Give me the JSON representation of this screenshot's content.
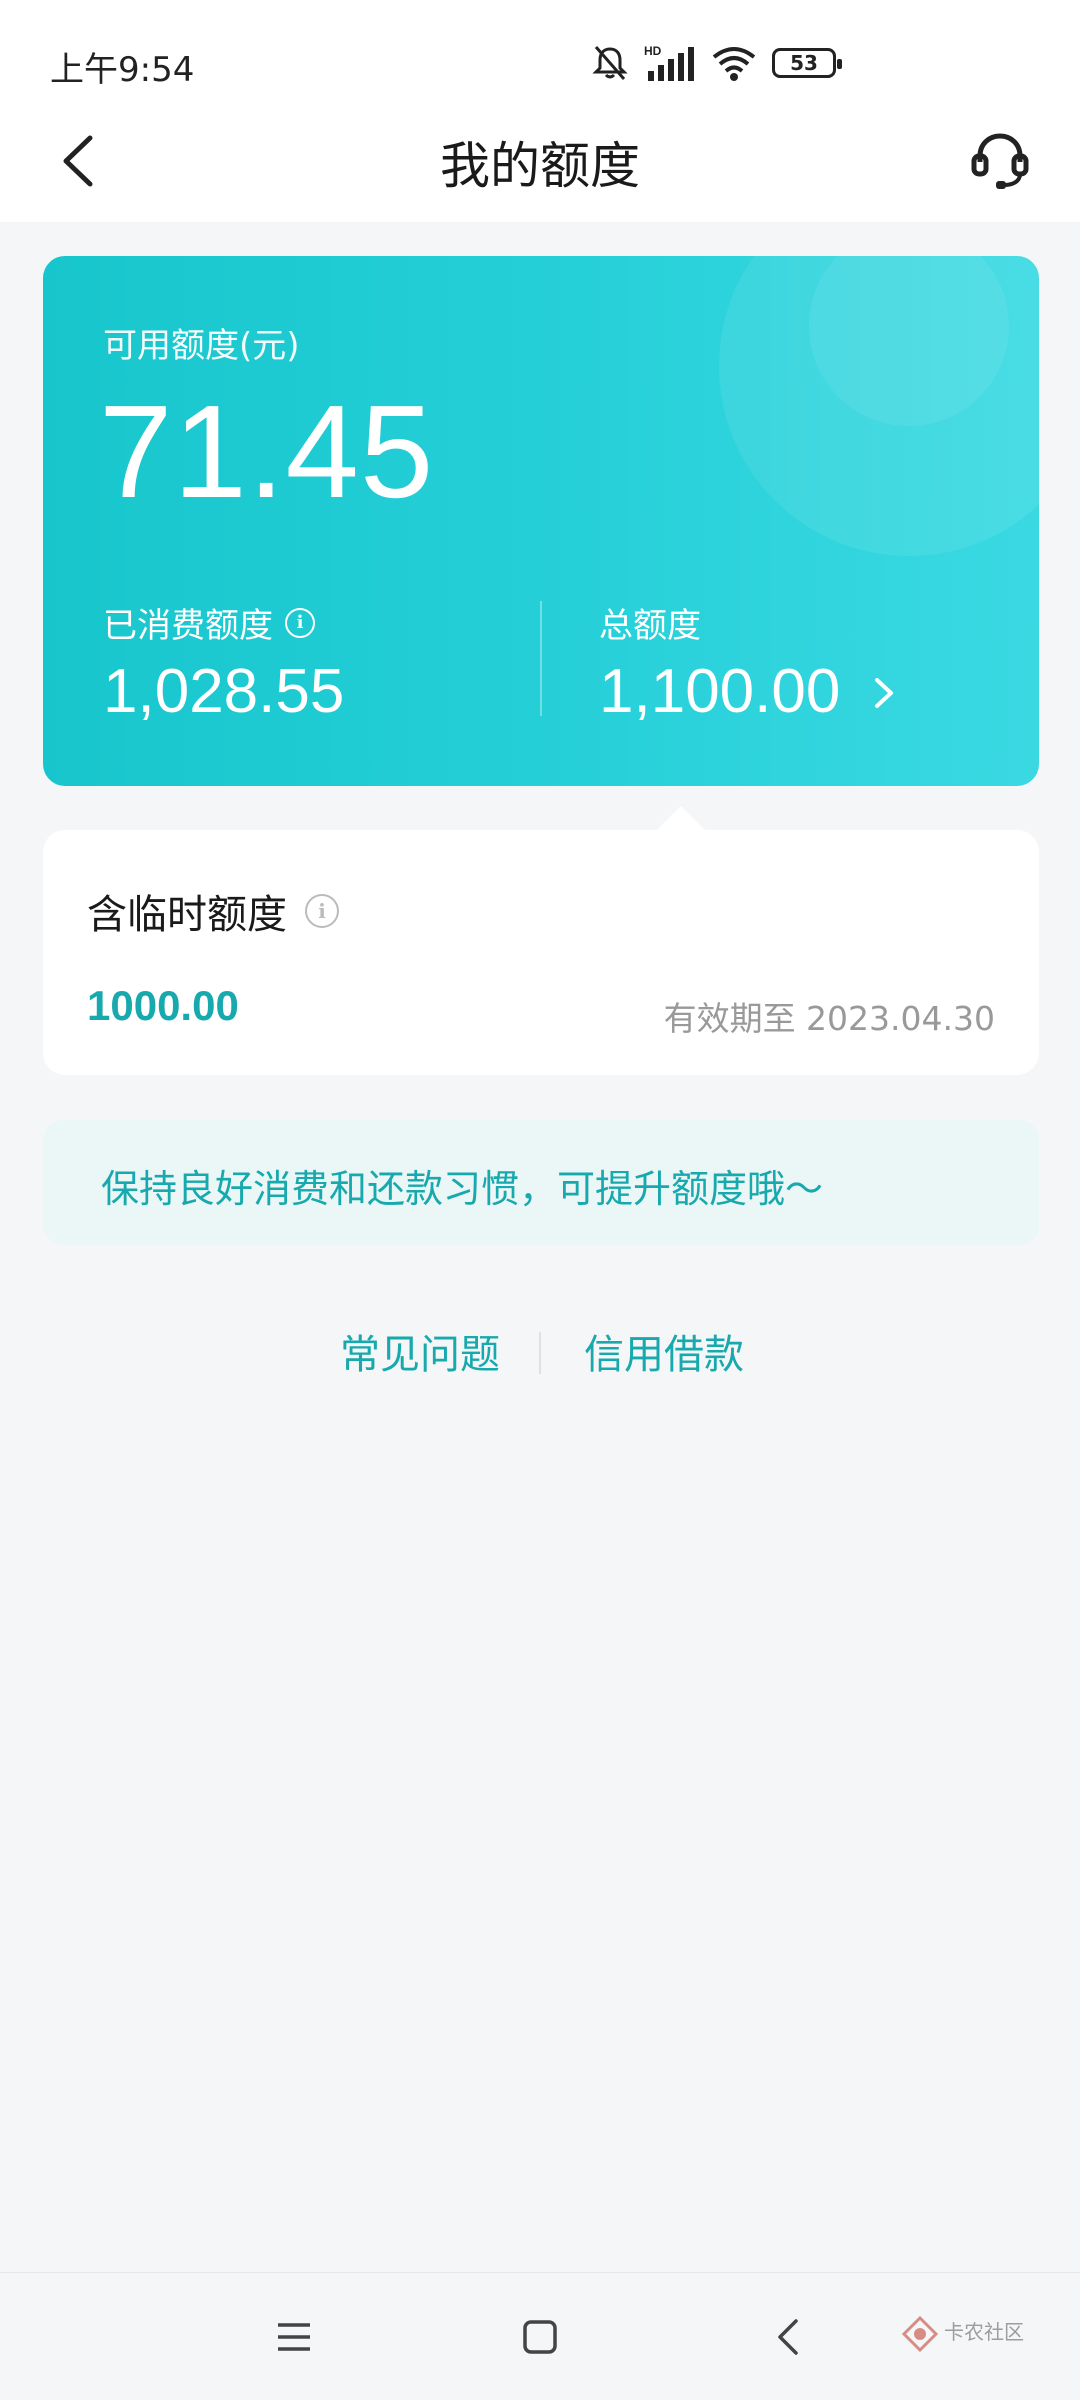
{
  "status_bar": {
    "time": "上午9:54",
    "battery": "53",
    "icons": [
      "mute-bell-icon",
      "hd-signal-icon",
      "wifi-icon",
      "battery-icon"
    ]
  },
  "nav": {
    "title": "我的额度",
    "back_icon": "chevron-left-icon",
    "service_icon": "headset-icon"
  },
  "quota_card": {
    "available_label": "可用额度(元)",
    "available_amount": "71.45",
    "used_label": "已消费额度",
    "used_amount": "1,028.55",
    "total_label": "总额度",
    "total_amount": "1,100.00",
    "colors": {
      "gradient_start": "#17c6cc",
      "gradient_end": "#3ad9e2"
    }
  },
  "temp_quota": {
    "label": "含临时额度",
    "amount": "1000.00",
    "expiry": "有效期至 2023.04.30"
  },
  "tip": {
    "text": "保持良好消费和还款习惯，可提升额度哦～"
  },
  "links": {
    "faq": "常见问题",
    "credit_loan": "信用借款"
  },
  "system_nav": {
    "buttons": [
      "menu-icon",
      "home-icon",
      "back-icon"
    ]
  },
  "watermark": {
    "text": "卡农社区"
  },
  "accent_color": "#17a9ad"
}
